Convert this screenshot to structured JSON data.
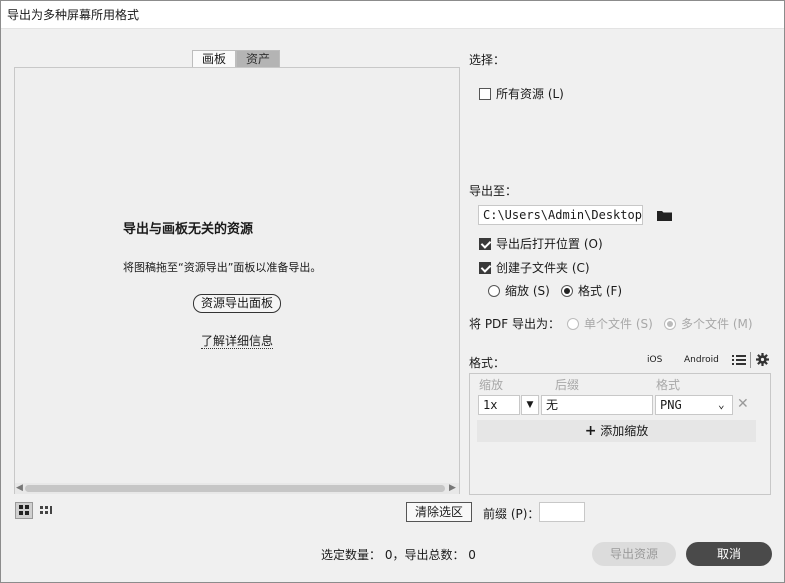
{
  "window": {
    "title": "导出为多种屏幕所用格式"
  },
  "tabs": [
    {
      "label": "画板"
    },
    {
      "label": "资产"
    }
  ],
  "preview": {
    "heading": "导出与画板无关的资源",
    "hint": "将图稿拖至“资源导出”面板以准备导出。",
    "panel_button": "资源导出面板",
    "learn_more": "了解详细信息"
  },
  "select": {
    "label": "选择：",
    "all_assets": {
      "label": "所有资源 (L)",
      "checked": false
    }
  },
  "export_to": {
    "label": "导出至：",
    "path": "C:\\Users\\Admin\\Desktop\\",
    "open_after": {
      "label": "导出后打开位置 (O)",
      "checked": true
    },
    "create_subfolder": {
      "label": "创建子文件夹 (C)",
      "checked": true
    },
    "scale_option": {
      "label": "缩放 (S)",
      "selected": false
    },
    "format_option": {
      "label": "格式 (F)",
      "selected": true
    }
  },
  "pdf_export": {
    "label": "将 PDF 导出为：",
    "single": "单个文件 (S)",
    "multiple": "多个文件 (M)"
  },
  "formats": {
    "label": "格式：",
    "ios": "iOS",
    "android": "Android",
    "columns": [
      "缩放",
      "后缀",
      "格式"
    ],
    "row": {
      "scale": "1x",
      "suffix": "无",
      "format": "PNG"
    },
    "add_scale": "添加缩放"
  },
  "bottom": {
    "clear_selection": "清除选区",
    "prefix_label": "前缀 (P)：",
    "prefix_value": "",
    "status": "选定数量： 0，导出总数： 0",
    "export_button": "导出资源",
    "cancel_button": "取消"
  }
}
